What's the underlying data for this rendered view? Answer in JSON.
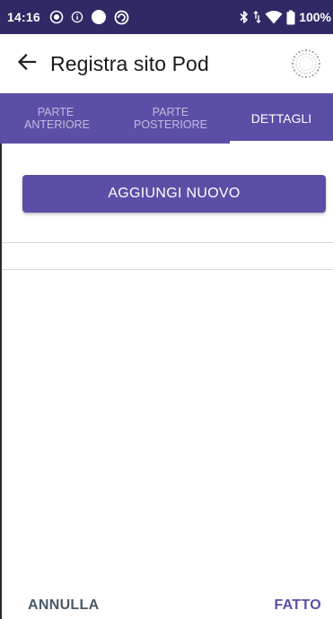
{
  "status_bar": {
    "time": "14:16",
    "battery": "100%",
    "left_icons": [
      "notification-dot-icon",
      "info-icon",
      "circle-icon",
      "sync-icon"
    ],
    "right_icons": [
      "bluetooth-icon",
      "data-arrows-icon",
      "wifi-icon",
      "battery-icon"
    ]
  },
  "app_bar": {
    "back_icon": "arrow-left-icon",
    "title": "Registra sito Pod",
    "logo_icon": "pod-logo-icon"
  },
  "tabs": [
    {
      "label": "PARTE ANTERIORE",
      "active": false
    },
    {
      "label": "PARTE POSTERIORE",
      "active": false
    },
    {
      "label": "DETTAGLI",
      "active": true
    }
  ],
  "main": {
    "add_button_label": "AGGIUNGI NUOVO"
  },
  "bottom_actions": {
    "cancel_label": "ANNULLA",
    "done_label": "FATTO"
  },
  "colors": {
    "status_bar": "#2f2966",
    "primary": "#5b4ea6",
    "cancel_text": "#4a5a66"
  }
}
